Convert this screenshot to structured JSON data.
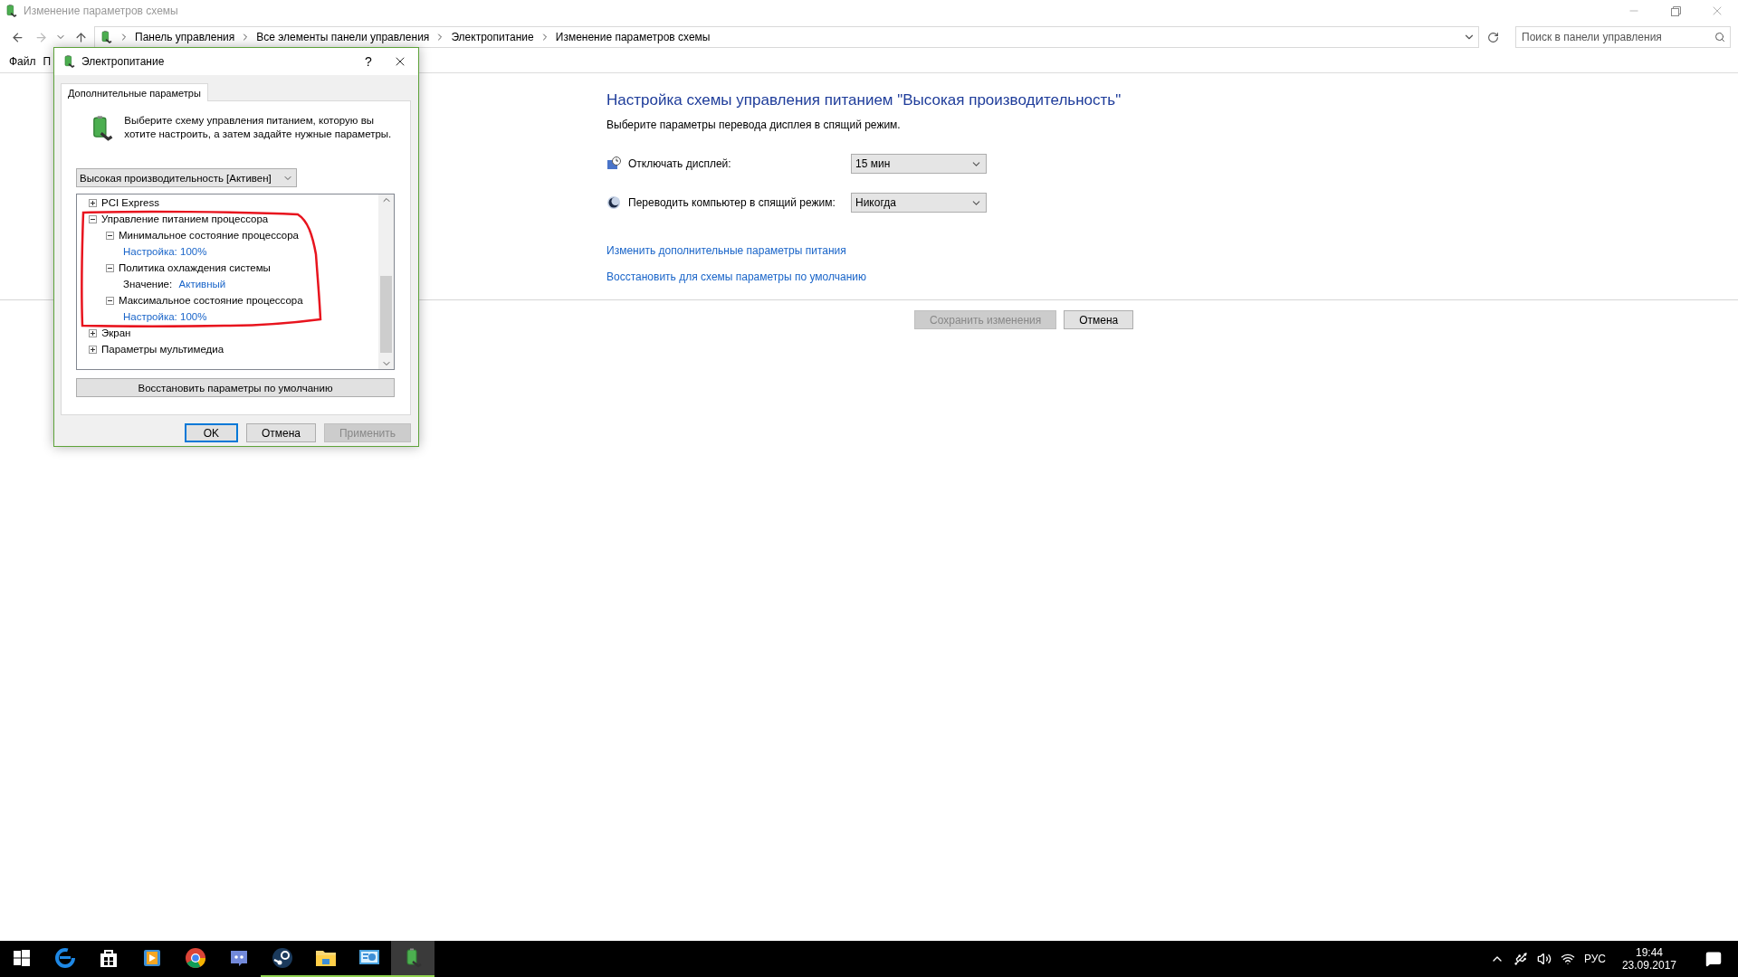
{
  "window": {
    "title": "Изменение параметров схемы"
  },
  "address_bar": {
    "crumbs": [
      "Панель управления",
      "Все элементы панели управления",
      "Электропитание",
      "Изменение параметров схемы"
    ]
  },
  "search": {
    "placeholder": "Поиск в панели управления"
  },
  "menu": [
    "Файл",
    "П"
  ],
  "plan": {
    "heading": "Настройка схемы управления питанием \"Высокая производительность\"",
    "subheading": "Выберите параметры перевода дисплея в спящий режим.",
    "settings": [
      {
        "kind": "display",
        "label": "Отключать дисплей:",
        "value": "15 мин"
      },
      {
        "kind": "sleep",
        "label": "Переводить компьютер в спящий режим:",
        "value": "Никогда"
      }
    ],
    "links": [
      "Изменить дополнительные параметры питания",
      "Восстановить для схемы параметры по умолчанию"
    ],
    "buttons": [
      {
        "label": "Сохранить изменения",
        "disabled": true
      },
      {
        "label": "Отмена",
        "disabled": false
      }
    ]
  },
  "dialog": {
    "title": "Электропитание",
    "help": "?",
    "tabs": [
      {
        "label": "Дополнительные параметры",
        "selected": true
      }
    ],
    "description": "Выберите схему управления питанием, которую вы хотите настроить, а затем задайте нужные параметры.",
    "scheme": "Высокая производительность [Активен]",
    "tree": [
      {
        "label": "PCI Express",
        "expanded": false
      },
      {
        "label": "Управление питанием процессора",
        "expanded": true,
        "children": [
          {
            "label": "Минимальное состояние процессора",
            "expanded": true,
            "children": [
              {
                "kind": "setting",
                "label": "Настройка:",
                "value": "100%"
              }
            ]
          },
          {
            "label": "Политика охлаждения системы",
            "expanded": true,
            "children": [
              {
                "kind": "value",
                "label": "Значение:",
                "value": "Активный"
              }
            ]
          },
          {
            "label": "Максимальное состояние процессора",
            "expanded": true,
            "children": [
              {
                "kind": "setting",
                "label": "Настройка:",
                "value": "100%"
              }
            ]
          }
        ]
      },
      {
        "label": "Экран",
        "expanded": false
      },
      {
        "label": "Параметры мультимедиа",
        "expanded": false
      }
    ],
    "restore_button": "Восстановить параметры по умолчанию",
    "buttons": [
      {
        "label": "OK",
        "default": true,
        "disabled": false
      },
      {
        "label": "Отмена",
        "default": false,
        "disabled": false
      },
      {
        "label": "Применить",
        "default": false,
        "disabled": true
      }
    ]
  },
  "taskbar": {
    "apps": [
      {
        "kind": "edge",
        "running": false,
        "active": false
      },
      {
        "kind": "store",
        "running": false,
        "active": false
      },
      {
        "kind": "player",
        "running": false,
        "active": false
      },
      {
        "kind": "chrome",
        "running": false,
        "active": false
      },
      {
        "kind": "chat",
        "running": false,
        "active": false
      },
      {
        "kind": "steam",
        "running": true,
        "active": false
      },
      {
        "kind": "folder",
        "running": true,
        "active": false
      },
      {
        "kind": "panel",
        "running": true,
        "active": false
      },
      {
        "kind": "power",
        "running": true,
        "active": true
      }
    ],
    "language": "РУС",
    "time": "19:44",
    "date": "23.09.2017"
  }
}
